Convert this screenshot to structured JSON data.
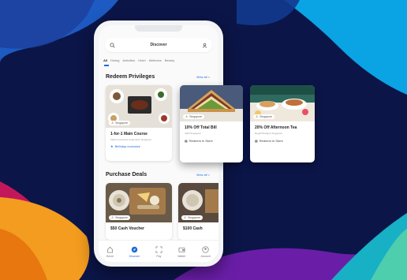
{
  "header": {
    "title": "Discover"
  },
  "tabs": [
    "All",
    "Dining",
    "Activities",
    "Hotel",
    "Wellness",
    "Beauty"
  ],
  "redeem": {
    "heading": "Redeem Privileges",
    "view_all": "View all >",
    "cards": [
      {
        "location": "Singapore",
        "title": "1-for-1 Main Course",
        "subtitle": "Valid at selected restaurants Singapore",
        "action": "Birthday exclusive"
      }
    ]
  },
  "floating": [
    {
      "location": "Singapore",
      "title": "10% Off Total Bill",
      "subtitle": "Valid Singapore",
      "action": "Redeem in Store"
    },
    {
      "location": "Singapore",
      "title": "20% Off Afternoon Tea",
      "subtitle": "Regal Boutique Singapore",
      "action": "Redeem in Store"
    }
  ],
  "deals": {
    "heading": "Purchase Deals",
    "view_all": "View all >",
    "cards": [
      {
        "location": "Singapore",
        "title": "$50 Cash Voucher"
      },
      {
        "location": "Singapore",
        "title": "$100 Cash"
      }
    ]
  },
  "bottom_nav": [
    {
      "label": "Home",
      "icon": "home-icon"
    },
    {
      "label": "Discover",
      "icon": "compass-icon",
      "active": true
    },
    {
      "label": "Pay",
      "icon": "scan-icon"
    },
    {
      "label": "Wallet",
      "icon": "wallet-icon"
    },
    {
      "label": "Account",
      "icon": "user-icon"
    }
  ],
  "colors": {
    "background": "#0b1548",
    "accent": "#1f6bd6",
    "orange": "#f39c1f",
    "magenta": "#c2185b",
    "cyan": "#0aa3e3"
  }
}
